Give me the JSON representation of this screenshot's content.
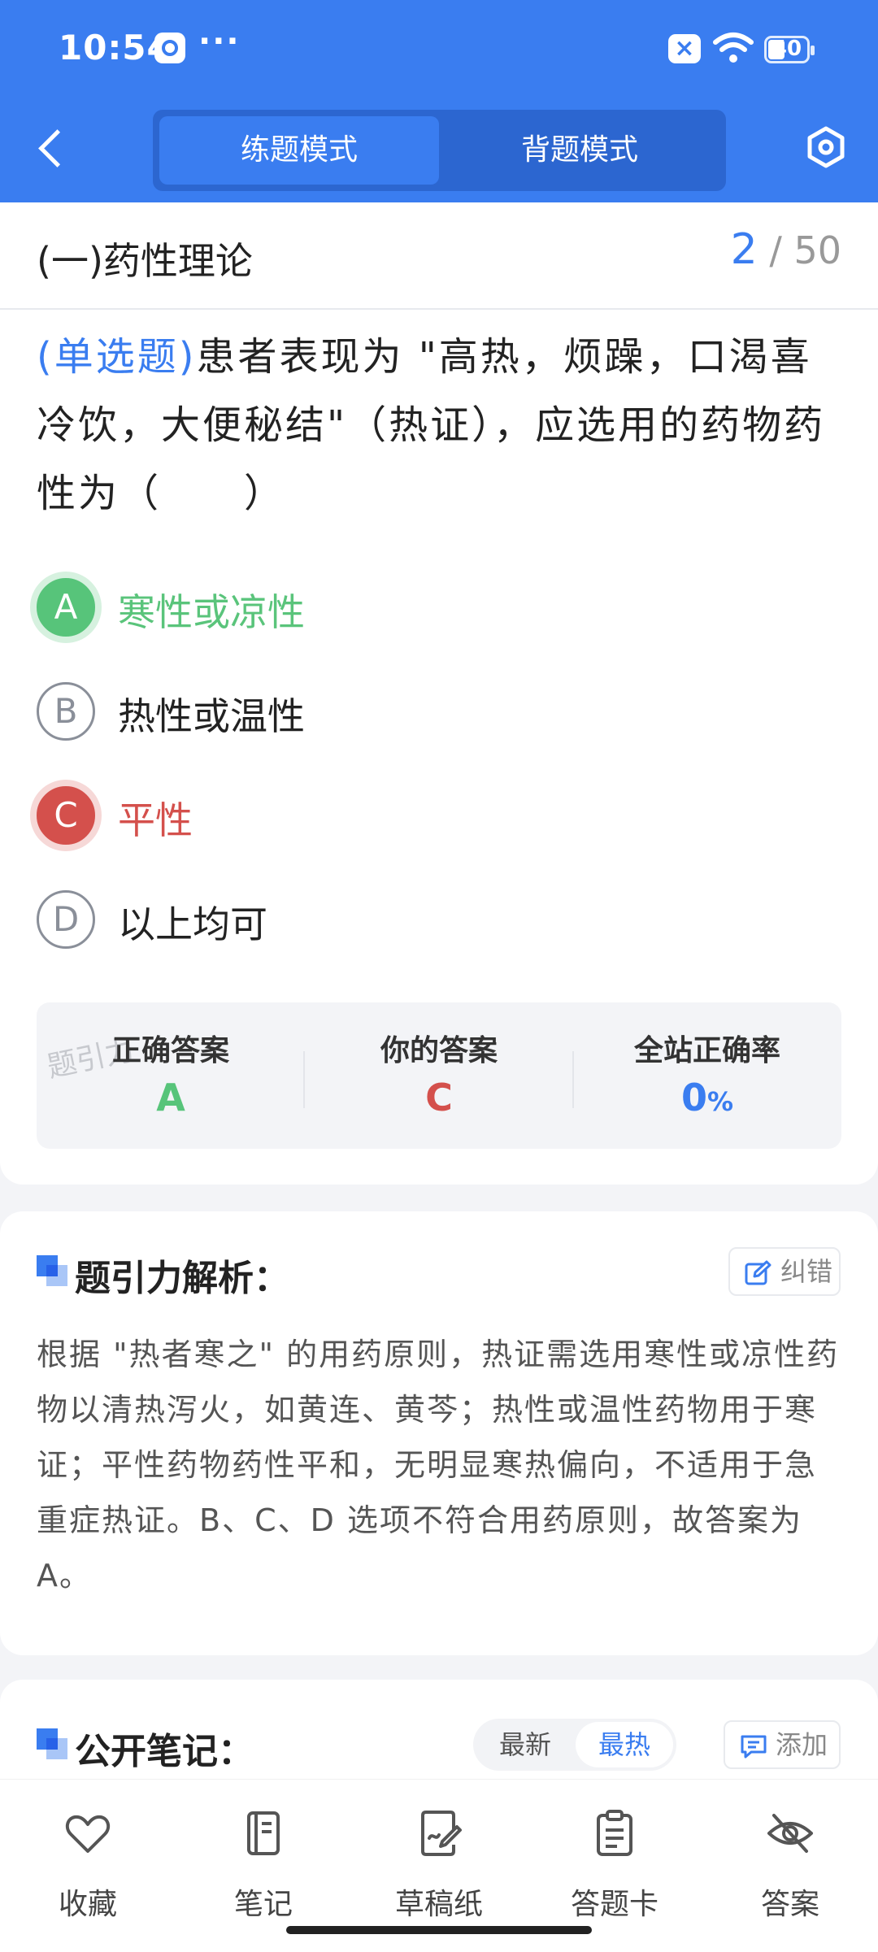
{
  "status_bar": {
    "time": "10:54",
    "dots": "···",
    "battery": "40"
  },
  "header": {
    "tabs": [
      {
        "label": "练题模式",
        "active": true
      },
      {
        "label": "背题模式",
        "active": false
      }
    ]
  },
  "section": {
    "title": "(一)药性理论",
    "current": "2",
    "total": "/ 50"
  },
  "question": {
    "type": "(单选题)",
    "text": "患者表现为 \"高热，烦躁，口渴喜冷饮，大便秘结\"（热证），应选用的药物药性为（　　）"
  },
  "options": [
    {
      "letter": "A",
      "text": "寒性或凉性",
      "state": "correct"
    },
    {
      "letter": "B",
      "text": "热性或温性",
      "state": "normal"
    },
    {
      "letter": "C",
      "text": "平性",
      "state": "wrong"
    },
    {
      "letter": "D",
      "text": "以上均可",
      "state": "normal"
    }
  ],
  "answers": {
    "correct_label": "正确答案",
    "correct_value": "A",
    "yours_label": "你的答案",
    "yours_value": "C",
    "rate_label": "全站正确率",
    "rate_value": "0",
    "rate_unit": "%",
    "watermark": "题引力"
  },
  "analysis": {
    "title": "题引力解析：",
    "report_label": "纠错",
    "text": "根据 \"热者寒之\" 的用药原则，热证需选用寒性或凉性药物以清热泻火，如黄连、黄芩；热性或温性药物用于寒证；平性药物药性平和，无明显寒热偏向，不适用于急重症热证。B、C、D 选项不符合用药原则，故答案为 A。"
  },
  "notes": {
    "title": "公开笔记：",
    "sort_latest": "最新",
    "sort_hot": "最热",
    "add_label": "添加"
  },
  "toolbar": [
    {
      "label": "收藏",
      "icon": "heart-icon"
    },
    {
      "label": "笔记",
      "icon": "notebook-icon"
    },
    {
      "label": "草稿纸",
      "icon": "draft-icon"
    },
    {
      "label": "答题卡",
      "icon": "answer-sheet-icon"
    },
    {
      "label": "答案",
      "icon": "eye-off-icon"
    }
  ],
  "colors": {
    "primary": "#3a7df0",
    "correct": "#57c47a",
    "wrong": "#d4504c"
  }
}
